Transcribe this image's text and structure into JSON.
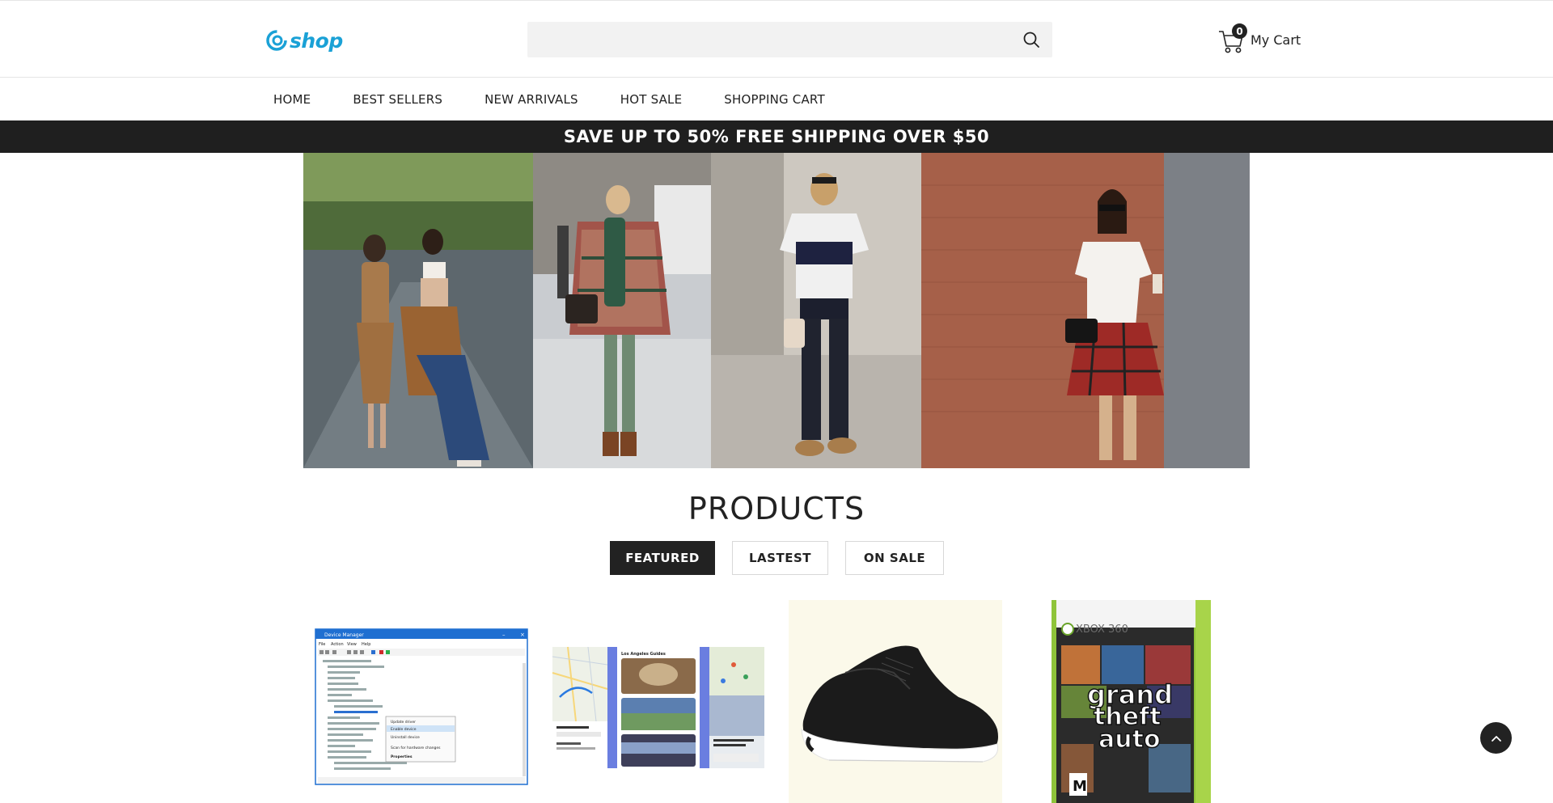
{
  "brand": {
    "logo_text": "shop",
    "accent": "#1aa1d6"
  },
  "search": {
    "placeholder": ""
  },
  "cart": {
    "count": "0",
    "label": "My Cart"
  },
  "nav": {
    "items": [
      "HOME",
      "BEST SELLERS",
      "NEW ARRIVALS",
      "HOT SALE",
      "SHOPPING CART"
    ]
  },
  "promo": {
    "text": "SAVE UP TO 50% FREE SHIPPING OVER $50"
  },
  "products": {
    "title": "PRODUCTS",
    "tabs": [
      "FEATURED",
      "LASTEST",
      "ON SALE"
    ],
    "active_tab": "FEATURED"
  },
  "product_thumbs": {
    "device_manager": {
      "window_title": "Device Manager",
      "menu": [
        "File",
        "Action",
        "View",
        "Help"
      ],
      "context_menu": [
        "Update driver",
        "Enable device",
        "Uninstall device",
        "Scan for hardware changes",
        "Properties"
      ]
    },
    "maps": {
      "heading": "Los Angeles Guides"
    },
    "game": {
      "platform": "XBOX 360",
      "title_lines": [
        "grand",
        "theft",
        "auto"
      ]
    }
  },
  "icons": {
    "search": "search-icon",
    "cart": "cart-icon",
    "scroll_top": "chevron-up-icon"
  }
}
